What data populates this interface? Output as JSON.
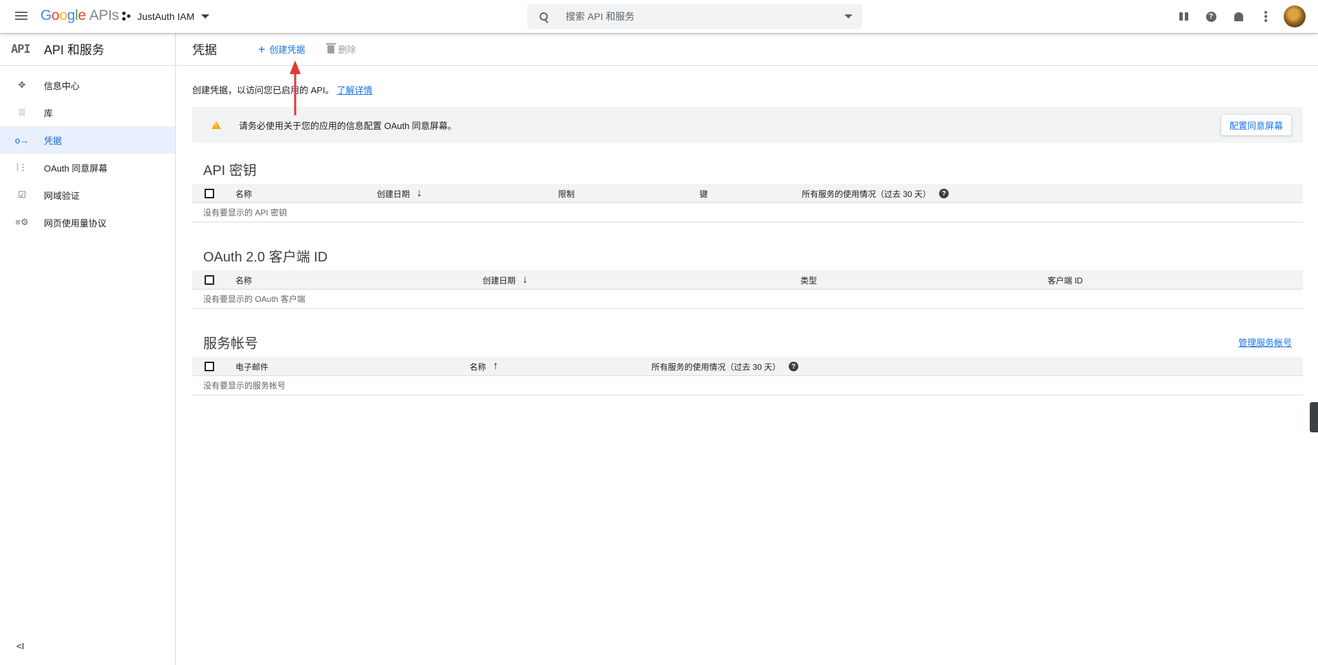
{
  "topbar": {
    "logo_text": "Google",
    "logo_suffix": "APIs",
    "project_name": "JustAuth IAM",
    "search_placeholder": "搜索 API 和服务",
    "icons": [
      "gift-icon",
      "help-icon",
      "bell-icon",
      "more-vert-icon",
      "avatar"
    ]
  },
  "sidebar": {
    "badge": "API",
    "title": "API 和服务",
    "items": [
      {
        "label": "信息中心",
        "icon": "dashboard-icon"
      },
      {
        "label": "库",
        "icon": "library-icon"
      },
      {
        "label": "凭据",
        "icon": "key-icon",
        "active": true
      },
      {
        "label": "OAuth 同意屏幕",
        "icon": "consent-icon"
      },
      {
        "label": "网域验证",
        "icon": "domain-check-icon"
      },
      {
        "label": "网页使用量协议",
        "icon": "settings-list-icon"
      }
    ],
    "collapse_icon": "<I"
  },
  "main": {
    "title": "凭据",
    "create_label": "创建凭据",
    "delete_label": "删除",
    "intro_text": "创建凭据，以访问您已启用的 API。",
    "intro_link": "了解详情",
    "banner_text": "请务必使用关于您的应用的信息配置 OAuth 同意屏幕。",
    "banner_button": "配置同意屏幕"
  },
  "api_keys": {
    "title": "API 密钥",
    "columns": [
      "名称",
      "创建日期",
      "限制",
      "键",
      "所有服务的使用情况（过去 30 天）"
    ],
    "empty": "没有要显示的 API 密钥"
  },
  "oauth": {
    "title": "OAuth 2.0 客户端 ID",
    "columns": [
      "名称",
      "创建日期",
      "类型",
      "客户端 ID"
    ],
    "empty": "没有要显示的 OAuth 客户端"
  },
  "service_accounts": {
    "title": "服务帐号",
    "manage_link": "管理服务帐号",
    "columns": [
      "电子邮件",
      "名称",
      "所有服务的使用情况（过去 30 天）"
    ],
    "empty": "没有要显示的服务帐号"
  },
  "colors": {
    "accent": "#1a73e8",
    "active_bg": "#e8f0fe",
    "warning": "#f9ab00",
    "annotation": "#e53935"
  }
}
